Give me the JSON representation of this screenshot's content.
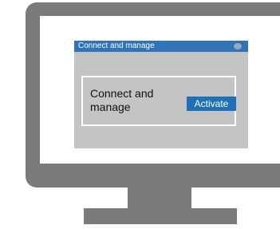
{
  "window": {
    "title": "Connect and manage"
  },
  "panel": {
    "text": "Connect and manage",
    "button_label": "Activate"
  },
  "colors": {
    "monitor": "#7b7b7b",
    "titlebar": "#2f73b9",
    "window_bg": "#c4c4c4",
    "button": "#1f6fb9"
  },
  "icons": {
    "window_control": "dot-icon"
  }
}
